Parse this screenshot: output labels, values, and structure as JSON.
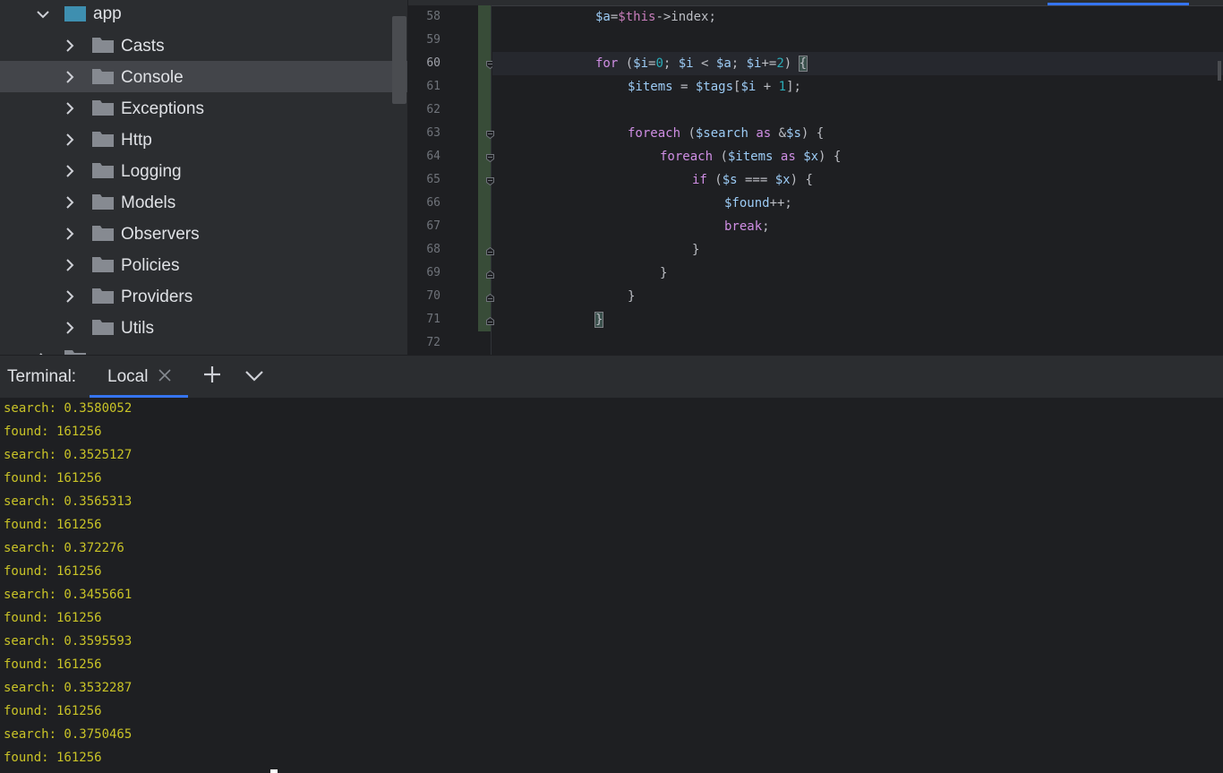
{
  "project_tree": {
    "root_folder": "app",
    "items": [
      {
        "label": "Casts"
      },
      {
        "label": "Console",
        "selected": true
      },
      {
        "label": "Exceptions"
      },
      {
        "label": "Http"
      },
      {
        "label": "Logging"
      },
      {
        "label": "Models"
      },
      {
        "label": "Observers"
      },
      {
        "label": "Policies"
      },
      {
        "label": "Providers"
      },
      {
        "label": "Utils"
      }
    ]
  },
  "editor": {
    "line_numbers": [
      "58",
      "59",
      "60",
      "61",
      "62",
      "63",
      "64",
      "65",
      "66",
      "67",
      "68",
      "69",
      "70",
      "71",
      "72"
    ],
    "current_line": "60",
    "code": [
      "$a=$this->index;",
      "",
      "for ($i=0; $i < $a; $i+=2) {",
      "$items = $tags[$i + 1];",
      "",
      "foreach ($search as &$s) {",
      "foreach ($items as $x) {",
      "if ($s === $x) {",
      "$found++;",
      "break;",
      "}",
      "}",
      "}",
      "}",
      ""
    ]
  },
  "terminal": {
    "title": "Terminal:",
    "tab_label": "Local",
    "add_icon": "plus-icon",
    "menu_icon": "chevron-down-icon",
    "lines": [
      "search: 0.3580052",
      "found: 161256",
      "search: 0.3525127",
      "found: 161256",
      "search: 0.3565313",
      "found: 161256",
      "search: 0.372276",
      "found: 161256",
      "search: 0.3455661",
      "found: 161256",
      "search: 0.3595593",
      "found: 161256",
      "search: 0.3532287",
      "found: 161256",
      "search: 0.3750465",
      "found: 161256"
    ]
  },
  "colors": {
    "accent": "#3574f0",
    "terminal_text": "#c9c327",
    "keyword": "#cf8ee4",
    "variable": "#9ccbf5",
    "number": "#2aacb8"
  }
}
